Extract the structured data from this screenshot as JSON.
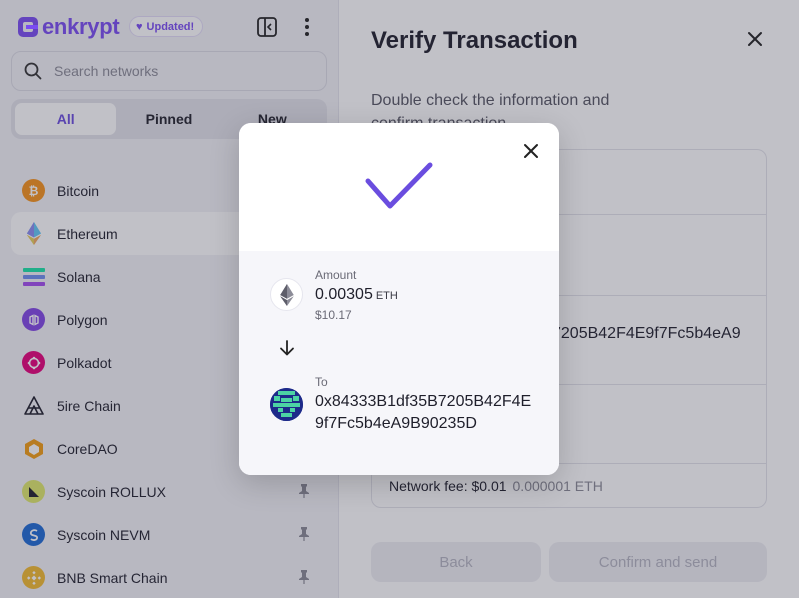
{
  "sidebar": {
    "brand": "enkrypt",
    "badge": "Updated!",
    "search_placeholder": "Search networks",
    "tabs": [
      {
        "label": "All",
        "active": true
      },
      {
        "label": "Pinned",
        "active": false
      },
      {
        "label": "New",
        "active": false
      }
    ],
    "networks": [
      {
        "name": "Bitcoin",
        "icon": "bitcoin-icon",
        "color": "#f7931a",
        "glyph": "₿",
        "pinned": false,
        "selected": false
      },
      {
        "name": "Ethereum",
        "icon": "ethereum-icon",
        "color": "#627eea",
        "glyph": "",
        "pinned": false,
        "selected": true
      },
      {
        "name": "Solana",
        "icon": "solana-icon",
        "color": "#9945ff",
        "glyph": "",
        "pinned": false,
        "selected": false
      },
      {
        "name": "Polygon",
        "icon": "polygon-icon",
        "color": "#8247e5",
        "glyph": "",
        "pinned": false,
        "selected": false
      },
      {
        "name": "Polkadot",
        "icon": "polkadot-icon",
        "color": "#e6007a",
        "glyph": "",
        "pinned": false,
        "selected": false
      },
      {
        "name": "5ire Chain",
        "icon": "5ire-icon",
        "color": "#1f1f2b",
        "glyph": "",
        "pinned": false,
        "selected": false
      },
      {
        "name": "CoreDAO",
        "icon": "coredao-icon",
        "color": "#f39c12",
        "glyph": "",
        "pinned": false,
        "selected": false
      },
      {
        "name": "Syscoin ROLLUX",
        "icon": "rollux-icon",
        "color": "#dfe86a",
        "glyph": "",
        "pinned": true,
        "selected": false
      },
      {
        "name": "Syscoin NEVM",
        "icon": "syscoin-icon",
        "color": "#1e6ad4",
        "glyph": "",
        "pinned": true,
        "selected": false
      },
      {
        "name": "BNB Smart Chain",
        "icon": "bnb-icon",
        "color": "#f3ba2f",
        "glyph": "",
        "pinned": true,
        "selected": false
      }
    ]
  },
  "main": {
    "title": "Verify Transaction",
    "description": "Double check the information and confirm transaction",
    "partial_address": "7205B42F4E9f7Fc5b4eA9",
    "fee_label": "Network fee: $0.01",
    "fee_eth": "0.000001 ETH",
    "back_label": "Back",
    "confirm_label": "Confirm and send"
  },
  "modal": {
    "amount_label": "Amount",
    "amount_value": "0.00305",
    "amount_unit": "ETH",
    "amount_usd": "$10.17",
    "to_label": "To",
    "to_address": "0x84333B1df35B7205B42F4E9f7Fc5b4eA9B90235D"
  },
  "colors": {
    "accent": "#7a4cf2",
    "check": "#6a4ddf"
  }
}
